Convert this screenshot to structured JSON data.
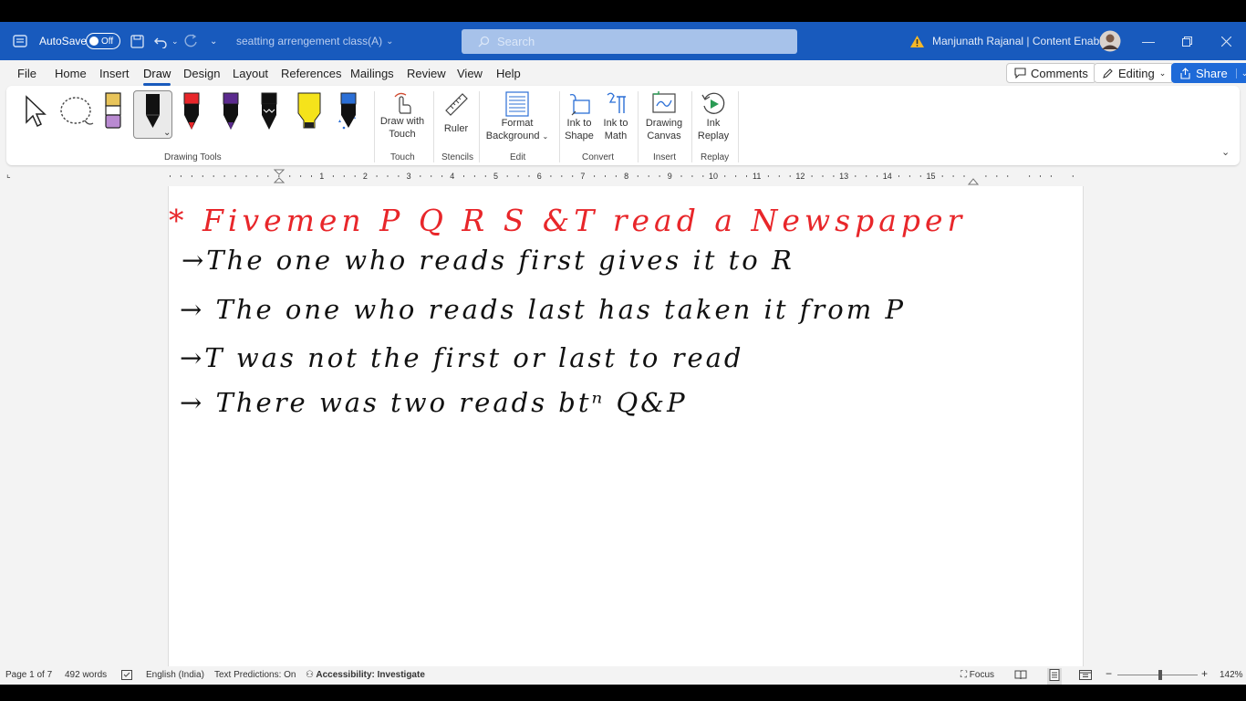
{
  "titlebar": {
    "autosave_label": "AutoSave",
    "autosave_state": "Off",
    "doc_title": "seatting arrengement class(A)",
    "search_placeholder": "Search",
    "user_name": "Manjunath Rajanal | Content Enablers"
  },
  "menu": {
    "tabs": [
      {
        "label": "File"
      },
      {
        "label": "Home"
      },
      {
        "label": "Insert"
      },
      {
        "label": "Draw"
      },
      {
        "label": "Design"
      },
      {
        "label": "Layout"
      },
      {
        "label": "References"
      },
      {
        "label": "Mailings"
      },
      {
        "label": "Review"
      },
      {
        "label": "View"
      },
      {
        "label": "Help"
      }
    ],
    "active_tab": "Draw",
    "comments_label": "Comments",
    "editing_label": "Editing",
    "share_label": "Share"
  },
  "ribbon": {
    "groups": {
      "drawing_tools": "Drawing Tools",
      "touch": "Touch",
      "stencils": "Stencils",
      "edit": "Edit",
      "convert": "Convert",
      "insert": "Insert",
      "replay": "Replay"
    },
    "tools": {
      "draw_with_touch_1": "Draw with",
      "draw_with_touch_2": "Touch",
      "ruler": "Ruler",
      "format_background_1": "Format",
      "format_background_2": "Background",
      "ink_to_shape_1": "Ink to",
      "ink_to_shape_2": "Shape",
      "ink_to_math_1": "Ink to",
      "ink_to_math_2": "Math",
      "drawing_canvas_1": "Drawing",
      "drawing_canvas_2": "Canvas",
      "ink_replay_1": "Ink",
      "ink_replay_2": "Replay"
    },
    "pen_colors": [
      "#e8c45a",
      "#111111",
      "#e8262a",
      "#5b2a8e",
      "#111111",
      "#f5e31b",
      "#2b6fd6"
    ]
  },
  "ruler": {
    "numbers": [
      "1",
      "2",
      "3",
      "4",
      "5",
      "6",
      "7",
      "8",
      "9",
      "10",
      "11",
      "12",
      "13",
      "14",
      "15"
    ]
  },
  "document": {
    "heading": "* Fivemen  P Q R S &T read a Newspaper",
    "lines": [
      "→The one who reads first gives it to R",
      "→ The one who reads last has taken it from P",
      "→T was not the first or last to read",
      "→  There was two reads btⁿ Q&P"
    ]
  },
  "statusbar": {
    "page": "Page 1 of 7",
    "words": "492 words",
    "language": "English (India)",
    "text_predictions": "Text Predictions: On",
    "accessibility": "Accessibility: Investigate",
    "focus": "Focus",
    "zoom": "142%"
  }
}
